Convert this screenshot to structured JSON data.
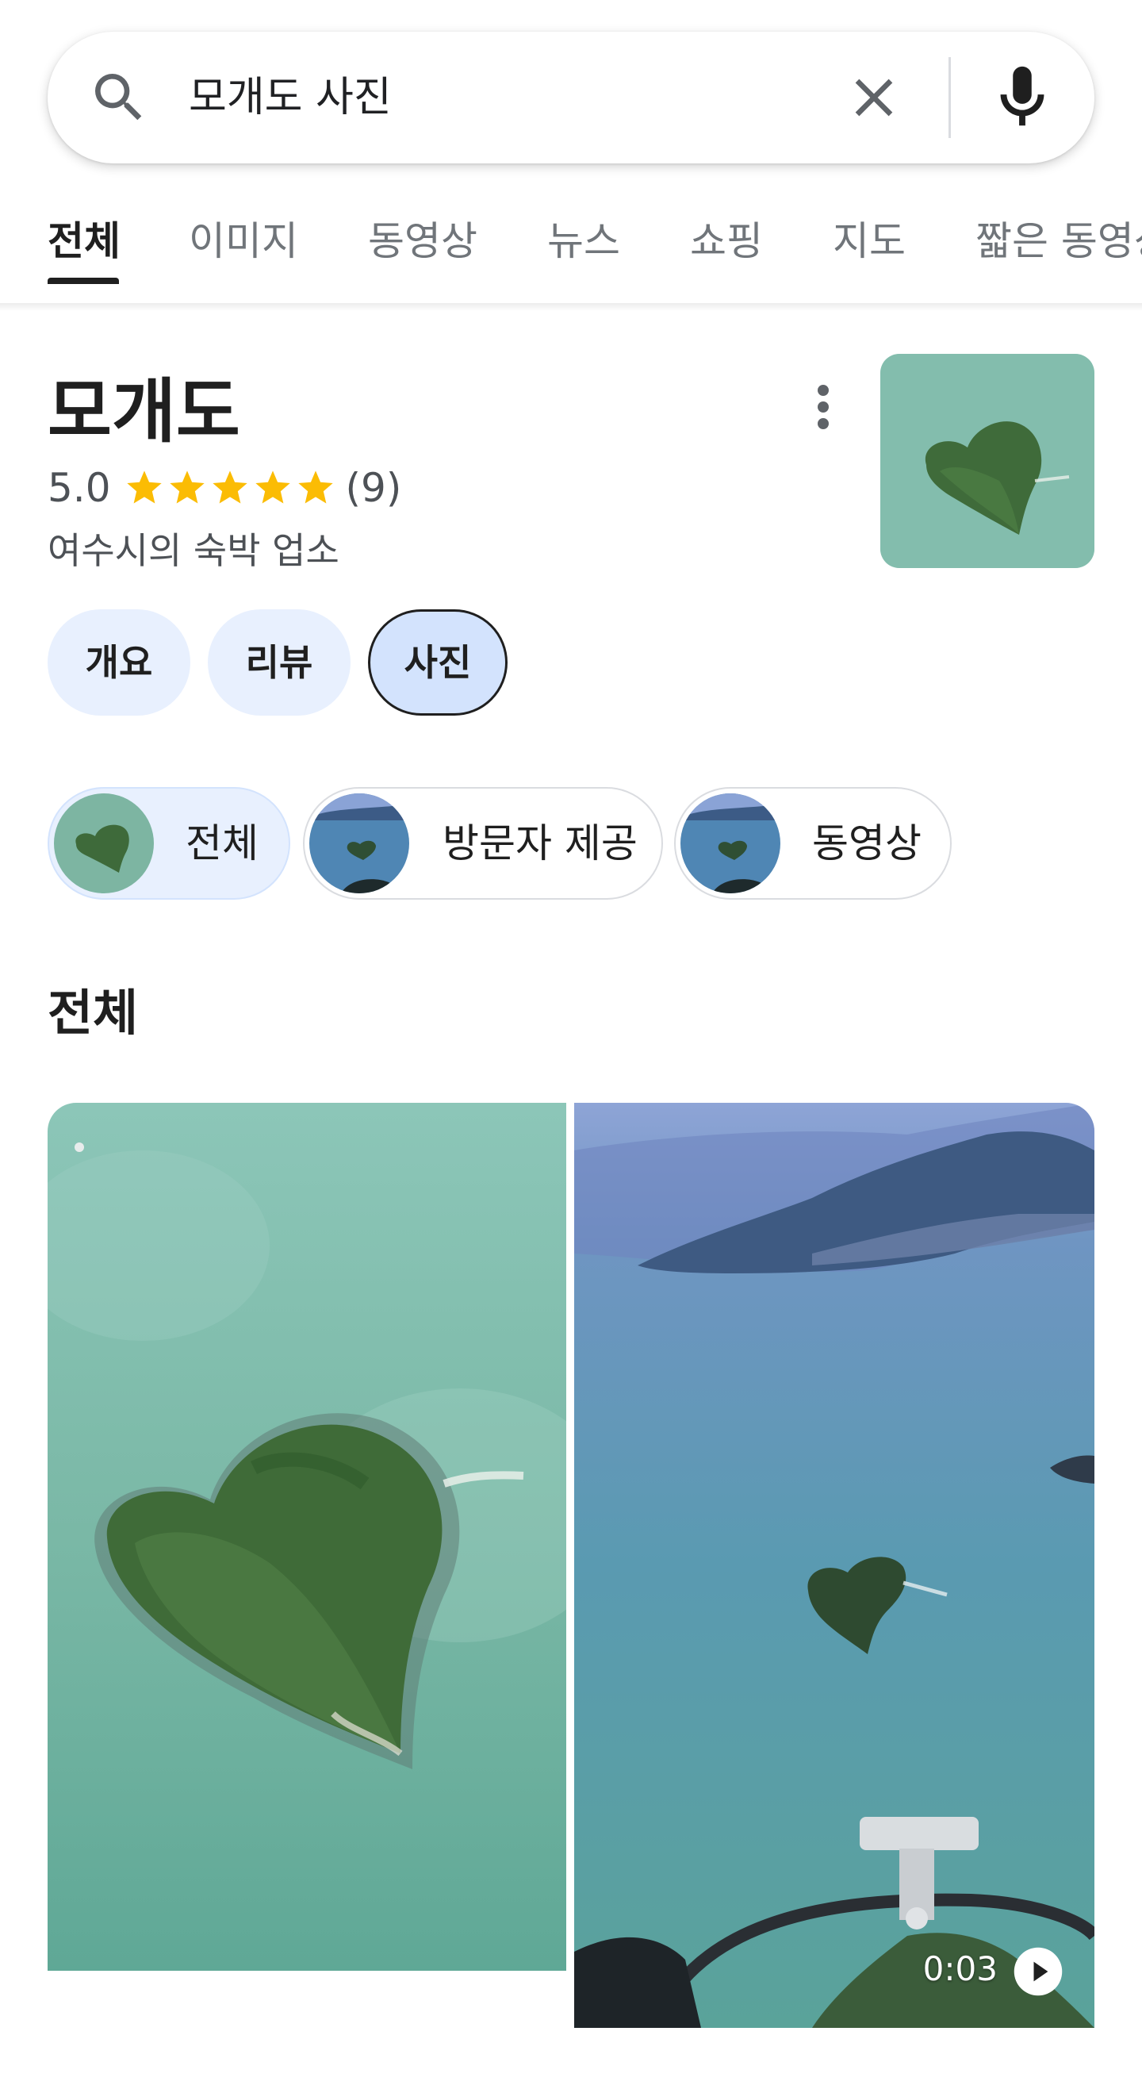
{
  "search": {
    "query": "모개도 사진"
  },
  "tabs": [
    {
      "label": "전체",
      "active": true
    },
    {
      "label": "이미지"
    },
    {
      "label": "동영상"
    },
    {
      "label": "뉴스"
    },
    {
      "label": "쇼핑"
    },
    {
      "label": "지도"
    },
    {
      "label": "짧은 동영상"
    }
  ],
  "entity": {
    "title": "모개도",
    "rating": "5.0",
    "rating_stars": 5,
    "review_count": "(9)",
    "subtitle": "여수시의 숙박 업소",
    "star_color": "#fbbc04"
  },
  "chips": [
    {
      "label": "개요"
    },
    {
      "label": "리뷰"
    },
    {
      "label": "사진",
      "selected": true
    }
  ],
  "filters": [
    {
      "label": "전체",
      "selected": true
    },
    {
      "label": "방문자 제공"
    },
    {
      "label": "동영상"
    }
  ],
  "section": {
    "title": "전체"
  },
  "photos": {
    "video_duration": "0:03"
  },
  "colors": {
    "accent": "#1a73e8",
    "chip_bg": "#e8f0fe",
    "chip_selected_bg": "#d3e3fd",
    "sea": "#6fb3a3"
  }
}
